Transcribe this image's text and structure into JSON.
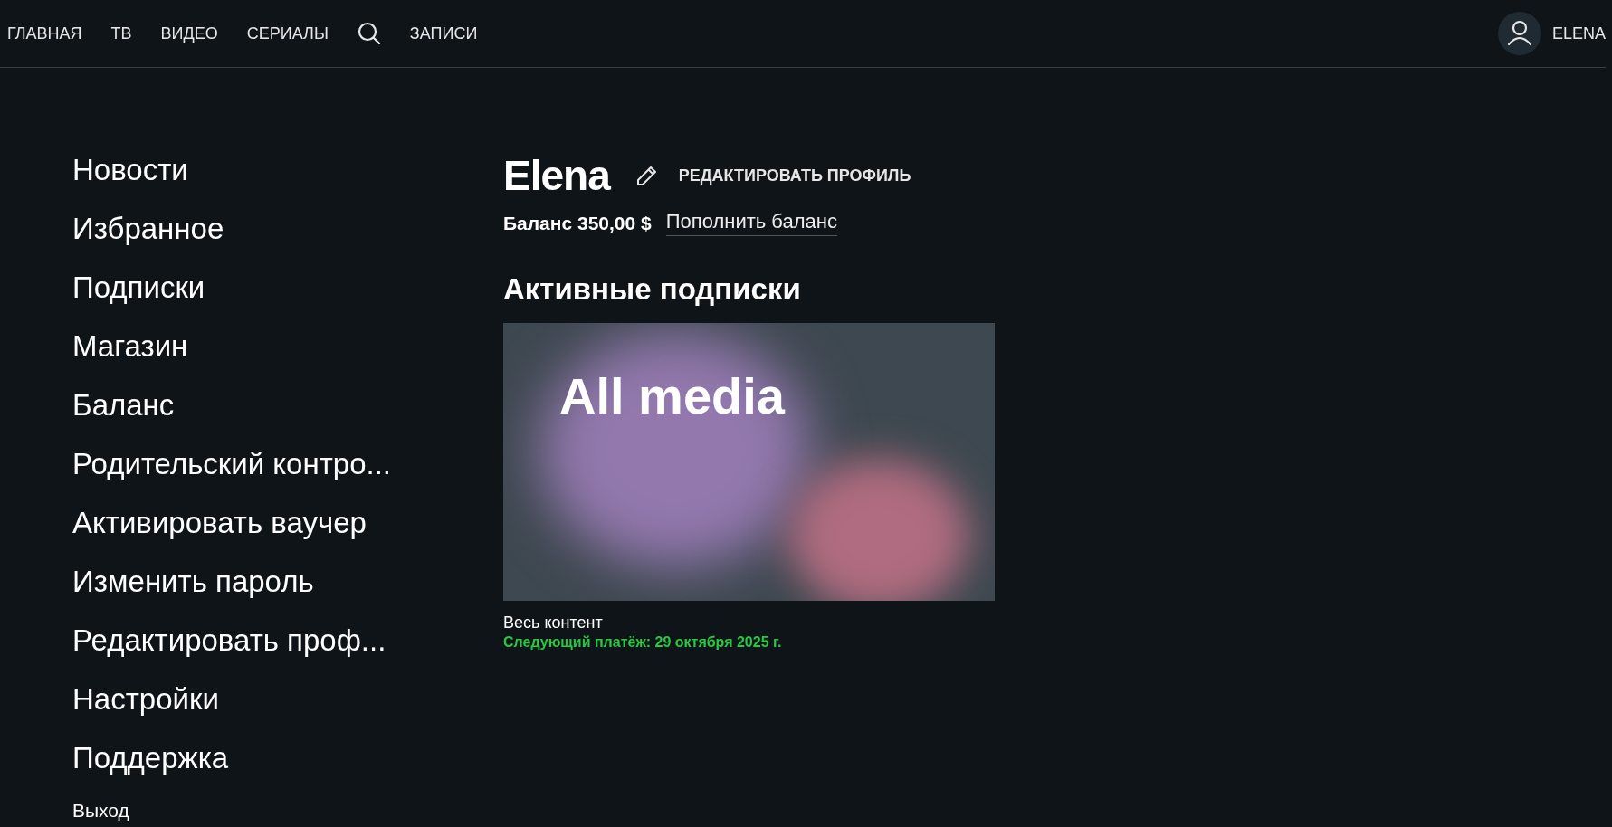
{
  "nav": {
    "items": [
      {
        "kind": "link",
        "label": "ГЛАВНАЯ"
      },
      {
        "kind": "link",
        "label": "ТВ"
      },
      {
        "kind": "link",
        "label": "ВИДЕО"
      },
      {
        "kind": "link",
        "label": "СЕРИАЛЫ"
      },
      {
        "kind": "search"
      },
      {
        "kind": "link",
        "label": "ЗАПИСИ"
      }
    ],
    "user": "ELENA"
  },
  "sidebar": {
    "items": [
      "Новости",
      "Избранное",
      "Подписки",
      "Магазин",
      "Баланс",
      "Родительский контро...",
      "Активировать ваучер",
      "Изменить пароль",
      "Редактировать проф...",
      "Настройки",
      "Поддержка"
    ],
    "logout": "Выход"
  },
  "profile": {
    "name": "Elena",
    "edit_label": "РЕДАКТИРОВАТЬ ПРОФИЛЬ",
    "balance": "Баланс 350,00 $",
    "top_up": "Пополнить баланс"
  },
  "subscriptions": {
    "title": "Активные подписки",
    "items": [
      {
        "banner_title": "All media",
        "name": "Весь контент",
        "next_payment": "Следующий платёж: 29 октября 2025 г."
      }
    ]
  }
}
